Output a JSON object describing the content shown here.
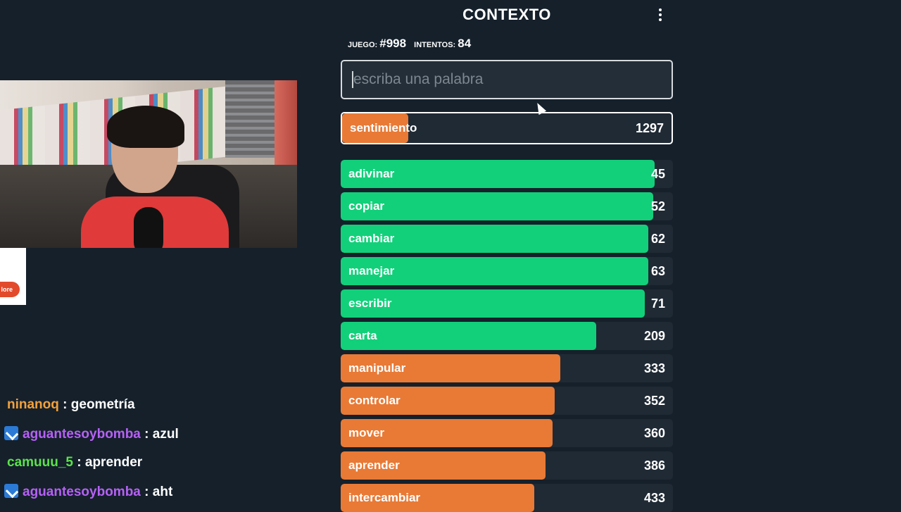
{
  "game": {
    "title": "CONTEXTO",
    "game_label": "JUEGO:",
    "game_number": "#998",
    "attempts_label": "INTENTOS:",
    "attempts": "84",
    "input_placeholder": "escriba una palabra",
    "current_guess": {
      "word": "sentimiento",
      "rank": "1297",
      "fill_fraction": 0.2
    },
    "guesses": [
      {
        "word": "adivinar",
        "rank": "45",
        "color": "#12d07a",
        "fill_fraction": 0.945
      },
      {
        "word": "copiar",
        "rank": "52",
        "color": "#12d07a",
        "fill_fraction": 0.94
      },
      {
        "word": "cambiar",
        "rank": "62",
        "color": "#12d07a",
        "fill_fraction": 0.925
      },
      {
        "word": "manejar",
        "rank": "63",
        "color": "#12d07a",
        "fill_fraction": 0.925
      },
      {
        "word": "escribir",
        "rank": "71",
        "color": "#12d07a",
        "fill_fraction": 0.915
      },
      {
        "word": "carta",
        "rank": "209",
        "color": "#12d07a",
        "fill_fraction": 0.77
      },
      {
        "word": "manipular",
        "rank": "333",
        "color": "#e87a36",
        "fill_fraction": 0.66
      },
      {
        "word": "controlar",
        "rank": "352",
        "color": "#e87a36",
        "fill_fraction": 0.645
      },
      {
        "word": "mover",
        "rank": "360",
        "color": "#e87a36",
        "fill_fraction": 0.638
      },
      {
        "word": "aprender",
        "rank": "386",
        "color": "#e87a36",
        "fill_fraction": 0.617
      },
      {
        "word": "intercambiar",
        "rank": "433",
        "color": "#e87a36",
        "fill_fraction": 0.582
      }
    ]
  },
  "overlay": {
    "pill_text": "lore"
  },
  "chat": [
    {
      "user": "ninanoq",
      "color": "#f2a13b",
      "message": "geometría",
      "badge": false
    },
    {
      "user": "aguantesoybomba",
      "color": "#b661f5",
      "message": "azul",
      "badge": true
    },
    {
      "user": "camuuu_5",
      "color": "#5be34a",
      "message": "aprender",
      "badge": false
    },
    {
      "user": "aguantesoybomba",
      "color": "#b661f5",
      "message": "aht",
      "badge": true
    }
  ]
}
